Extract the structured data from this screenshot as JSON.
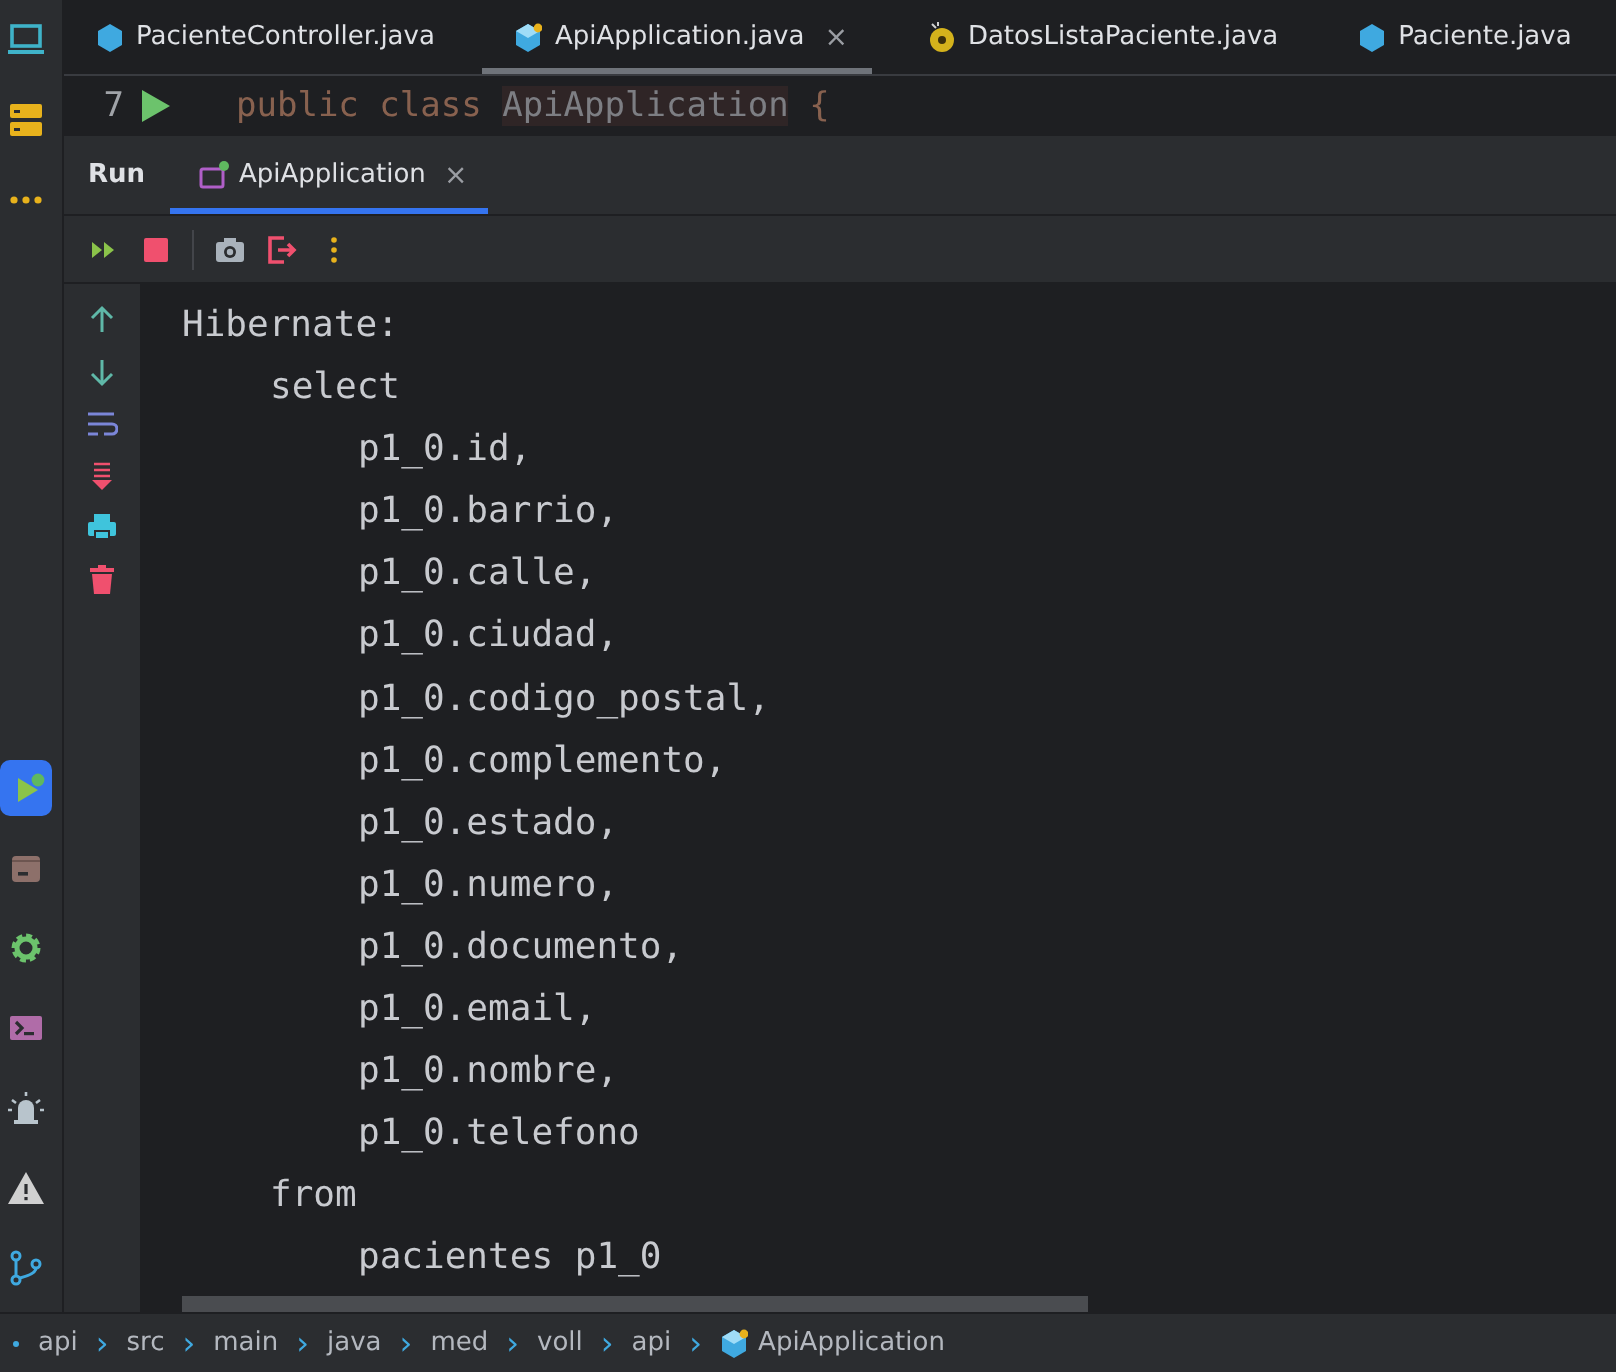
{
  "sidebar": {
    "top_tools": [
      {
        "kind": "laptop",
        "selected": false
      },
      {
        "kind": "server",
        "selected": false
      },
      {
        "kind": "more",
        "selected": false
      }
    ],
    "bottom_tools": [
      {
        "kind": "run",
        "selected": true
      },
      {
        "kind": "box",
        "selected": false
      },
      {
        "kind": "gear",
        "selected": false
      },
      {
        "kind": "terminal",
        "selected": false
      },
      {
        "kind": "alarm",
        "selected": false
      },
      {
        "kind": "warning",
        "selected": false
      },
      {
        "kind": "git",
        "selected": false
      }
    ]
  },
  "editor_tabs": [
    {
      "label": "PacienteController.java",
      "kind": "class",
      "selected": false
    },
    {
      "label": "ApiApplication.java",
      "kind": "app",
      "selected": true,
      "close": "×"
    },
    {
      "label": "DatosListaPaciente.java",
      "kind": "record",
      "selected": false
    },
    {
      "label": "Paciente.java",
      "kind": "class",
      "selected": false
    }
  ],
  "editor": {
    "line_number": "7",
    "keyword": "public class",
    "identifier": "ApiApplication",
    "brace": "{"
  },
  "run_panel": {
    "title": "Run",
    "tabs": [
      {
        "label": "ApiApplication",
        "selected": true,
        "close": "×"
      }
    ],
    "toolbar": [
      {
        "kind": "rerun"
      },
      {
        "kind": "stop"
      },
      {
        "kind": "screenshot"
      },
      {
        "kind": "exit"
      },
      {
        "kind": "more"
      }
    ],
    "gutter": [
      {
        "kind": "up"
      },
      {
        "kind": "down"
      },
      {
        "kind": "wrap"
      },
      {
        "kind": "scroll-end"
      },
      {
        "kind": "print"
      },
      {
        "kind": "delete"
      }
    ],
    "console": [
      {
        "text": "Hibernate:",
        "children": [
          {
            "text": "select",
            "children": [
              {
                "text": "p1_0.id,"
              },
              {
                "text": "p1_0.barrio,"
              },
              {
                "text": "p1_0.calle,"
              },
              {
                "text": "p1_0.ciudad,"
              },
              {
                "text": "p1_0.codigo_postal,"
              },
              {
                "text": "p1_0.complemento,"
              },
              {
                "text": "p1_0.estado,"
              },
              {
                "text": "p1_0.numero,"
              },
              {
                "text": "p1_0.documento,"
              },
              {
                "text": "p1_0.email,"
              },
              {
                "text": "p1_0.nombre,"
              },
              {
                "text": "p1_0.telefono"
              }
            ]
          },
          {
            "text": "from",
            "children": [
              {
                "text": "pacientes p1_0"
              }
            ]
          }
        ]
      }
    ]
  },
  "breadcrumbs": [
    {
      "label": "api"
    },
    {
      "label": "src"
    },
    {
      "label": "main"
    },
    {
      "label": "java"
    },
    {
      "label": "med"
    },
    {
      "label": "voll"
    },
    {
      "label": "api"
    },
    {
      "label": "ApiApplication",
      "kind": "app"
    }
  ],
  "breadcrumb_separator": "›"
}
